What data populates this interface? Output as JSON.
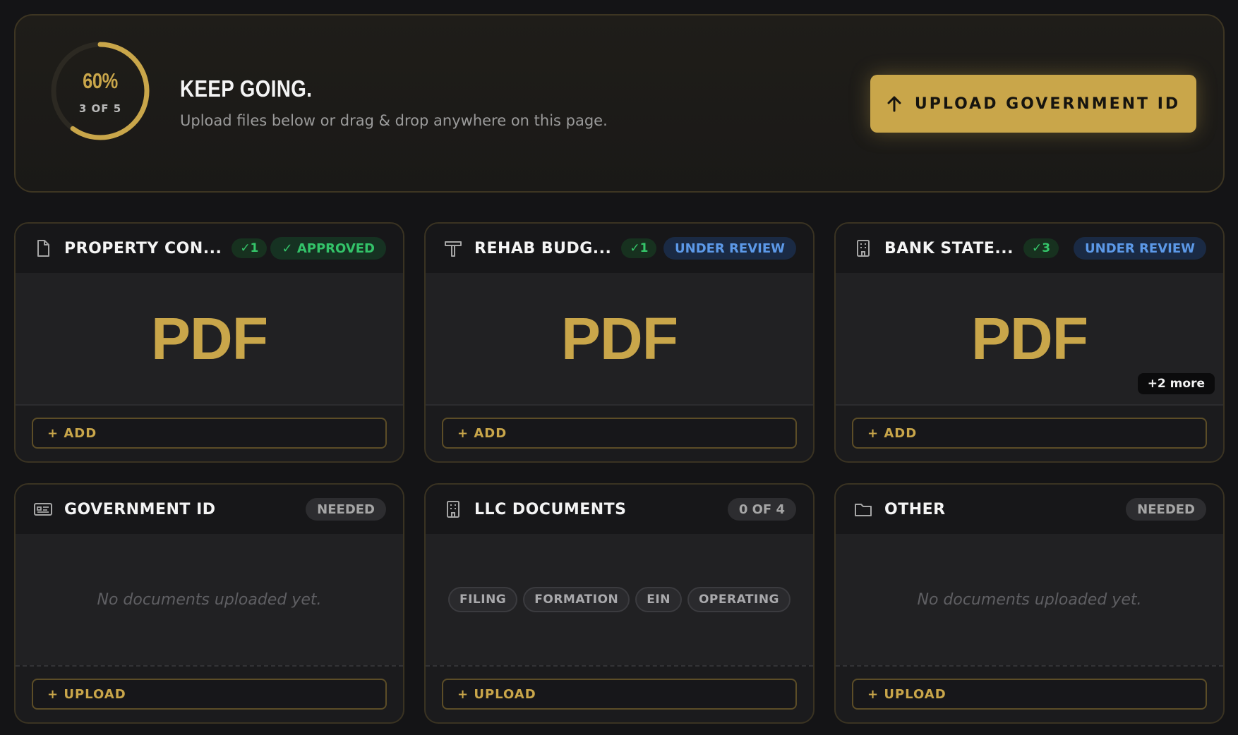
{
  "progress": {
    "percent_label": "60%",
    "fraction": 0.6,
    "count_label": "3 OF 5"
  },
  "hero": {
    "title": "KEEP GOING.",
    "subtitle": "Upload files below or drag & drop anywhere on this page.",
    "button_label": "UPLOAD GOVERNMENT ID",
    "button_icon": "arrow-up-icon"
  },
  "colors": {
    "accent": "#c9a64a",
    "approved": "#33c369",
    "review": "#5c99e8",
    "needed": "#a6a6a6",
    "background": "#141416"
  },
  "cards": [
    {
      "title": "PROPERTY CON...",
      "icon": "file-icon",
      "count": "✓1",
      "status": "✓ APPROVED",
      "preview": "PDF",
      "action": "+ ADD"
    },
    {
      "title": "REHAB BUDG...",
      "icon": "hammer-icon",
      "count": "✓1",
      "status": "UNDER REVIEW",
      "preview": "PDF",
      "action": "+ ADD"
    },
    {
      "title": "BANK STATE...",
      "icon": "building-icon",
      "count": "✓3",
      "status": "UNDER REVIEW",
      "preview": "PDF",
      "more": "+2 more",
      "action": "+ ADD"
    },
    {
      "title": "GOVERNMENT ID",
      "icon": "id-card-icon",
      "status": "NEEDED",
      "empty": "No documents uploaded yet.",
      "action": "+ UPLOAD"
    },
    {
      "title": "LLC DOCUMENTS",
      "icon": "building-icon",
      "status": "0 OF 4",
      "chips": [
        "FILING",
        "FORMATION",
        "EIN",
        "OPERATING"
      ],
      "action": "+ UPLOAD"
    },
    {
      "title": "OTHER",
      "icon": "folder-icon",
      "status": "NEEDED",
      "empty": "No documents uploaded yet.",
      "action": "+ UPLOAD"
    }
  ]
}
